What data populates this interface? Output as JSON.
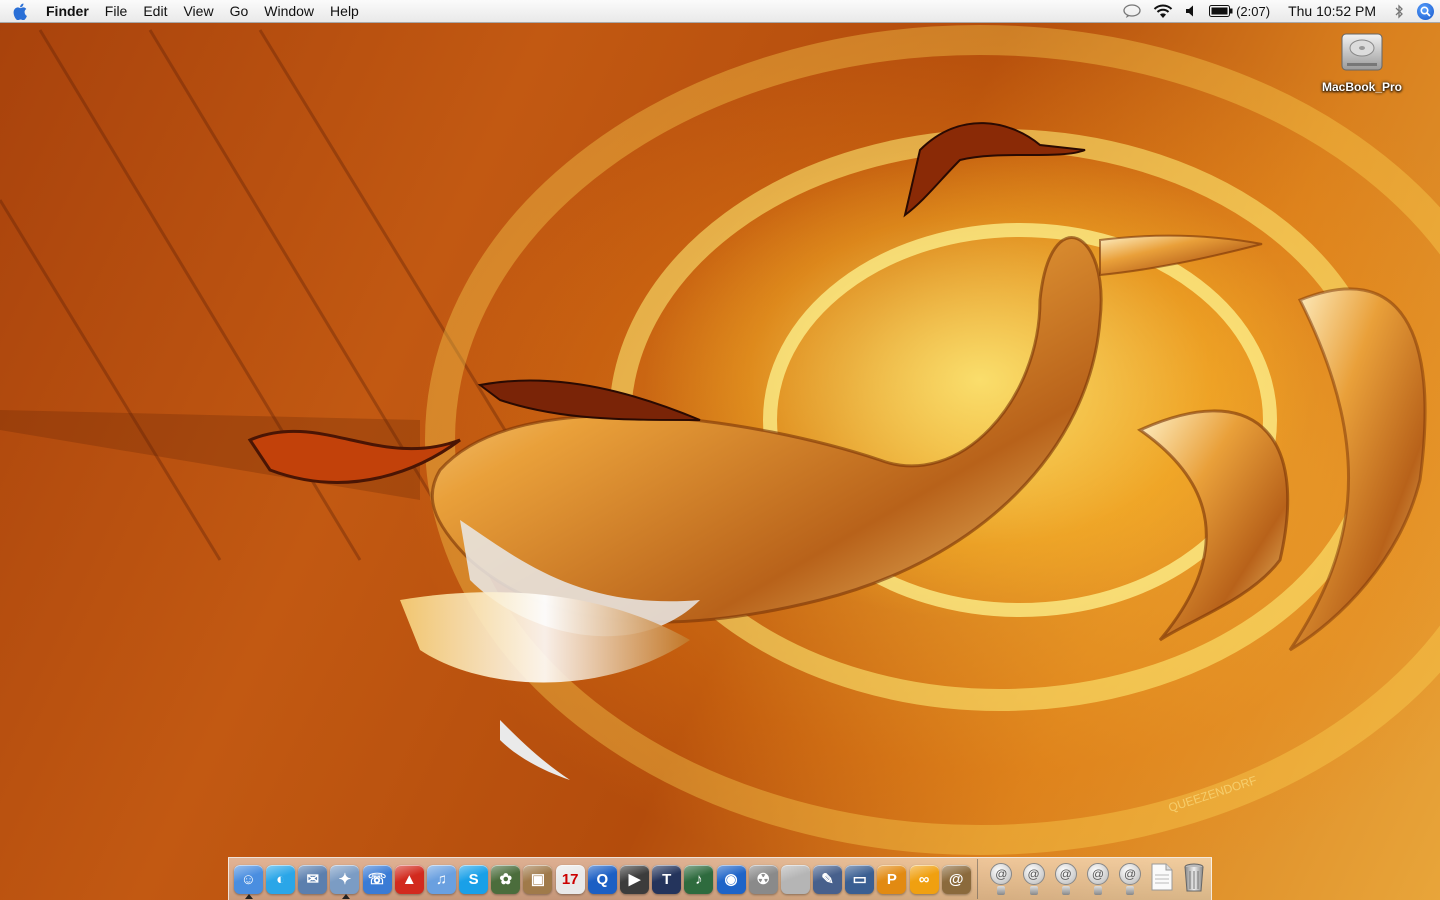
{
  "menubar": {
    "app_name": "Finder",
    "menus": [
      "File",
      "Edit",
      "View",
      "Go",
      "Window",
      "Help"
    ],
    "battery_text": "(2:07)",
    "clock": "Thu 10:52 PM"
  },
  "desktop": {
    "icons": [
      {
        "label": "MacBook_Pro",
        "icon": "hard-drive-icon"
      }
    ],
    "wallpaper_watermark": "QUEEZENDORF"
  },
  "dock": {
    "apps": [
      {
        "name": "finder-icon",
        "glyph": "☺",
        "color": "#4a8ee0",
        "running": true
      },
      {
        "name": "dashboard-icon",
        "glyph": "◐",
        "color": "#2aa6e8",
        "running": false
      },
      {
        "name": "mail-stamp-icon",
        "glyph": "✉",
        "color": "#5b7fae",
        "running": false
      },
      {
        "name": "safari-icon",
        "glyph": "✦",
        "color": "#7b9cc4",
        "running": true
      },
      {
        "name": "ichat-icon",
        "glyph": "☏",
        "color": "#3a7bd5",
        "running": false
      },
      {
        "name": "fire-hydrant-icon",
        "glyph": "▲",
        "color": "#d22a1e",
        "running": false
      },
      {
        "name": "itunes-icon",
        "glyph": "♫",
        "color": "#6aa0e0",
        "running": false
      },
      {
        "name": "skype-icon",
        "glyph": "S",
        "color": "#19a0e8",
        "running": false
      },
      {
        "name": "iphoto-icon",
        "glyph": "✿",
        "color": "#4b6d3c",
        "running": false
      },
      {
        "name": "preview-icon",
        "glyph": "▣",
        "color": "#a07a4a",
        "running": false
      },
      {
        "name": "ical-icon",
        "glyph": "17",
        "color": "#e9e9e9",
        "running": false
      },
      {
        "name": "quicktime-icon",
        "glyph": "Q",
        "color": "#1c5fc4",
        "running": false
      },
      {
        "name": "imovie-icon",
        "glyph": "▶",
        "color": "#3c3c3c",
        "running": false
      },
      {
        "name": "textedit-icon",
        "glyph": "T",
        "color": "#24345c",
        "running": false
      },
      {
        "name": "garageband-icon",
        "glyph": "♪",
        "color": "#2e6b3e",
        "running": false
      },
      {
        "name": "network-globe-icon",
        "glyph": "◉",
        "color": "#1e64c8",
        "running": false
      },
      {
        "name": "radioactive-icon",
        "glyph": "☢",
        "color": "#8a8a8a",
        "running": false
      },
      {
        "name": "apple-icon",
        "glyph": "",
        "color": "#b5b5b5",
        "running": false
      },
      {
        "name": "xcode-icon",
        "glyph": "✎",
        "color": "#47608c",
        "running": false
      },
      {
        "name": "presentation-icon",
        "glyph": "▭",
        "color": "#3a5f92",
        "running": false
      },
      {
        "name": "pages-icon",
        "glyph": "P",
        "color": "#e28a12",
        "running": false
      },
      {
        "name": "olympic-rings-icon",
        "glyph": "∞",
        "color": "#f0a010",
        "running": false
      },
      {
        "name": "address-book-icon",
        "glyph": "@",
        "color": "#8b6a3c",
        "running": false
      }
    ],
    "stacks": [
      {
        "name": "mail-folder-1-icon"
      },
      {
        "name": "mail-folder-2-icon"
      },
      {
        "name": "mail-folder-3-icon"
      },
      {
        "name": "mail-folder-4-icon"
      },
      {
        "name": "mail-folder-5-icon"
      },
      {
        "name": "document-icon"
      },
      {
        "name": "trash-icon"
      }
    ]
  }
}
